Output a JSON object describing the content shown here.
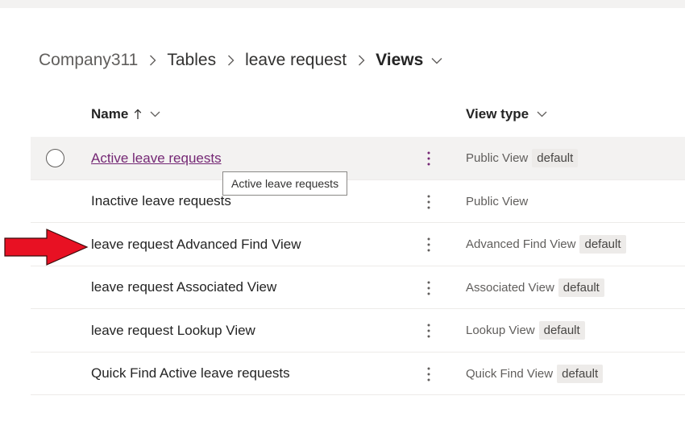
{
  "breadcrumb": {
    "items": [
      "Company311",
      "Tables",
      "leave request"
    ],
    "current": "Views"
  },
  "columns": {
    "name": "Name",
    "view_type": "View type"
  },
  "rows": [
    {
      "name": "Active leave requests",
      "type": "Public View",
      "badge": "default"
    },
    {
      "name": "Inactive leave requests",
      "type": "Public View",
      "badge": ""
    },
    {
      "name": "leave request Advanced Find View",
      "type": "Advanced Find View",
      "badge": "default"
    },
    {
      "name": "leave request Associated View",
      "type": "Associated View",
      "badge": "default"
    },
    {
      "name": "leave request Lookup View",
      "type": "Lookup View",
      "badge": "default"
    },
    {
      "name": "Quick Find Active leave requests",
      "type": "Quick Find View",
      "badge": "default"
    }
  ],
  "tooltip": {
    "text": "Active leave requests"
  },
  "colors": {
    "link": "#742774",
    "hover_row": "#f3f2f1",
    "annotation_arrow": "#e81123"
  },
  "icons": {
    "breadcrumb_separator": "chevron-right-icon",
    "breadcrumb_menu": "chevron-down-icon",
    "sort": "arrow-up-icon",
    "row_menu": "more-vertical-icon",
    "row_select": "circle-checkbox-icon",
    "annotation": "red-arrow-icon"
  }
}
